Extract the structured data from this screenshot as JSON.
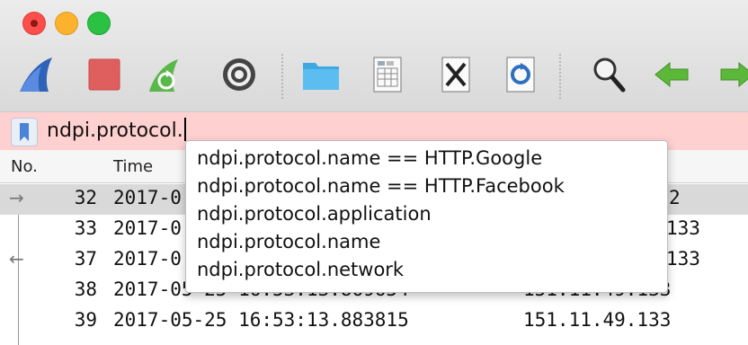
{
  "window": {
    "buttons": [
      "close",
      "minimize",
      "maximize"
    ]
  },
  "toolbar": {
    "icons": [
      "shark-fin-start-icon",
      "stop-capture-icon",
      "restart-capture-icon",
      "capture-options-icon",
      "open-folder-icon",
      "save-file-icon",
      "close-file-icon",
      "reload-file-icon",
      "find-packet-icon",
      "go-back-icon",
      "go-forward-icon"
    ]
  },
  "filter": {
    "value": "ndpi.protocol.",
    "background": "#ffd0d0"
  },
  "columns": {
    "no": "No.",
    "time": "Time"
  },
  "rows": [
    {
      "no": "32",
      "time": "2017-0",
      "src": "2",
      "selected": true
    },
    {
      "no": "33",
      "time": "2017-0",
      "src": "133"
    },
    {
      "no": "37",
      "time": "2017-0",
      "src": "133"
    },
    {
      "no": "38",
      "time": "2017-05-25 16:53:13.869654",
      "src": "151.11.49.133"
    },
    {
      "no": "39",
      "time": "2017-05-25 16:53:13.883815",
      "src": "151.11.49.133"
    }
  ],
  "autocomplete": [
    "ndpi.protocol.name == HTTP.Google",
    "ndpi.protocol.name == HTTP.Facebook",
    "ndpi.protocol.application",
    "ndpi.protocol.name",
    "ndpi.protocol.network"
  ]
}
